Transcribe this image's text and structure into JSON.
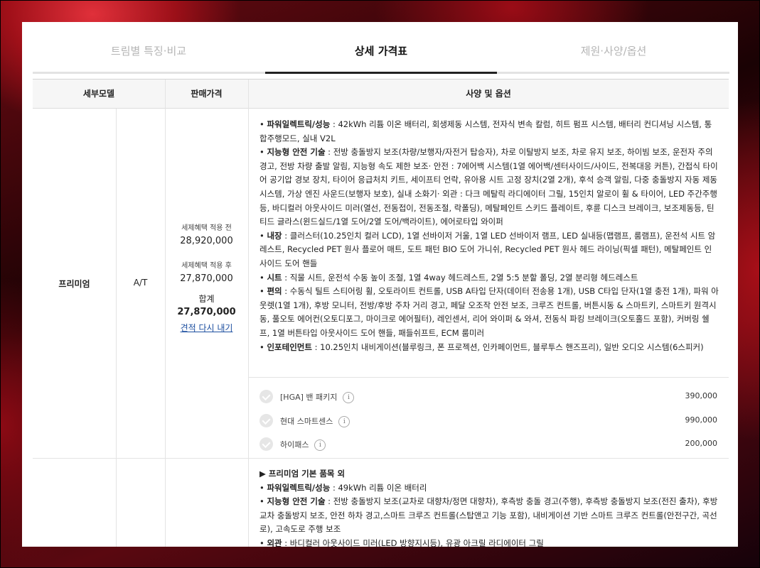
{
  "tabs": [
    {
      "label": "트림별 특징·비교",
      "active": false
    },
    {
      "label": "상세 가격표",
      "active": true
    },
    {
      "label": "제원·사양/옵션",
      "active": false
    }
  ],
  "table": {
    "headers": {
      "model": "세부모델",
      "price": "판매가격",
      "spec": "사양 및 옵션"
    },
    "rows": [
      {
        "trim": "프리미엄",
        "transmission": "A/T",
        "price": {
          "before_label": "세제혜택 적용 전",
          "before_value": "28,920,000",
          "after_label": "세제혜택 적용 후",
          "after_value": "27,870,000",
          "total_label": "합계",
          "total_value": "27,870,000",
          "requote": "견적 다시 내기"
        },
        "specs": [
          {
            "title": "파워일렉트릭/성능",
            "text": " : 42kWh 리튬 이온 배터리, 회생제동 시스템, 전자식 변속 칼럼, 히트 펌프 시스템, 배터리 컨디셔닝 시스템, 통합주행모드, 실내 V2L"
          },
          {
            "title": "지능형 안전 기술",
            "text": " : 전방 충돌방지 보조(차량/보행자/자전거 탑승자), 차로 이탈방지 보조, 차로 유지 보조, 하이빔 보조, 운전자 주의 경고, 전방 차량 출발 알림, 지능형 속도 제한 보조· 안전 : 7에어백 시스템(1열 에어백/센터사이드/사이드, 전복대응 커튼), 간접식 타이어 공기압 경보 장치, 타이어 응급처치 키트, 세이프티 언락, 유아용 시트 고정 장치(2열 2개), 후석 승객 알림, 다중 충돌방지 자동 제동 시스템, 가상 엔진 사운드(보행자 보호), 실내 소화기· 외관 : 다크 메탈릭 라디에이터 그릴, 15인치 알로이 휠 & 타이어, LED 주간주행등, 바디컬러 아웃사이드 미러(열선, 전동접이, 전동조절, 락폴딩), 메탈페인트 스키드 플레이트, 후륜 디스크 브레이크, 보조제동등, 틴티드 글라스(윈드실드/1열 도어/2열 도어/백라이트), 에어로타입 와이퍼"
          },
          {
            "title": "내장",
            "text": " : 클러스터(10.25인치 컬러 LCD), 1열 선바이저 거울, 1열 LED 선바이저 램프, LED 실내등(맵램프, 룸램프), 운전석 시트 암레스트, Recycled PET 원사 플로어 매트, 도트 패턴 BIO 도어 가니쉬, Recycled PET 원사 헤드 라이닝(픽셀 패턴), 메탈페인트 인사이드 도어 핸들"
          },
          {
            "title": "시트",
            "text": " : 직물 시트, 운전석 수동 높이 조절, 1열 4way 헤드레스트, 2열 5:5 분할 폴딩, 2열 분리형 헤드레스트"
          },
          {
            "title": "편의",
            "text": " : 수동식 틸트 스티어링 휠, 오토라이트 컨트롤, USB A타입 단자(데이터 전송용 1개), USB C타입 단자(1열 충전 1개), 파워 아웃렛(1열 1개), 후방 모니터, 전방/후방 주차 거리 경고, 페달 오조작 안전 보조, 크루즈 컨트롤, 버튼시동 & 스마트키, 스마트키 원격시동, 풀오토 에어컨(오토디포그, 마이크로 에어필터), 레인센서, 리어 와이퍼 & 와셔, 전동식 파킹 브레이크(오토홀드 포함), 커버링 쉘프, 1열 버튼타입 아웃사이드 도어 핸들, 패들쉬프트, ECM 룸미러"
          },
          {
            "title": "인포테인먼트",
            "text": " : 10.25인치 내비게이션(블루링크, 폰 프로젝션, 인카페이먼트, 블루투스 핸즈프리), 일반 오디오 시스템(6스피커)"
          }
        ],
        "options": [
          {
            "name": "[HGA] 밴 패키지",
            "price": "390,000"
          },
          {
            "name": "현대 스마트센스",
            "price": "990,000"
          },
          {
            "name": "하이패스",
            "price": "200,000"
          }
        ]
      },
      {
        "intro": "▶ 프리미엄 기본 품목 외",
        "specs": [
          {
            "title": "파워일렉트릭/성능",
            "text": " : 49kWh 리튬 이온 배터리"
          },
          {
            "title": "지능형 안전 기술",
            "text": " : 전방 충돌방지 보조(교차로 대향차/정면 대향차), 후측방 충돌 경고(주행), 후측방 충돌방지 보조(전진 출차), 후방 교차 충돌방지 보조, 안전 하차 경고,스마트 크루즈 컨트롤(스탑앤고 기능 포함), 내비게이션 기반 스마트 크루즈 컨트롤(안전구간, 곡선로), 고속도로 주행 보조"
          },
          {
            "title": "외관",
            "text": " : 바디컬러 아웃사이드 미러(LED 방향지시등), 유광 아크릴 라디에이터 그릴"
          }
        ]
      }
    ]
  }
}
